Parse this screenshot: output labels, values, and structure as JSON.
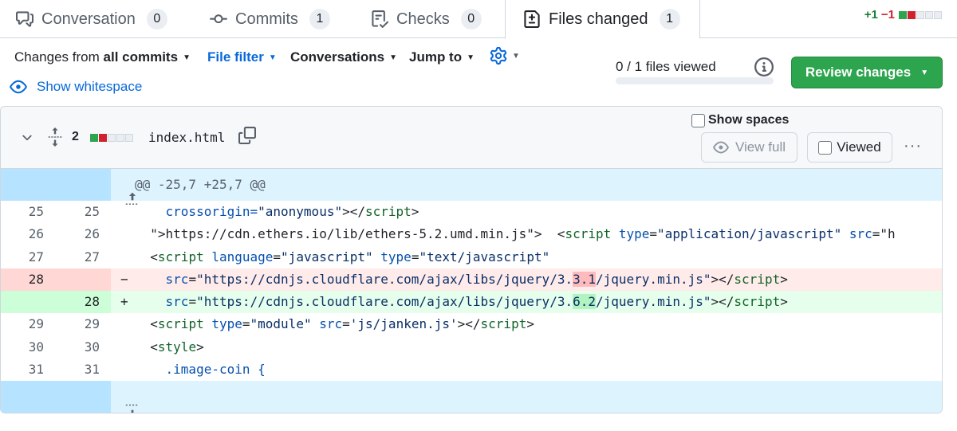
{
  "tabs": [
    {
      "label": "Conversation",
      "count": "0",
      "icon": "comment-discussion-icon"
    },
    {
      "label": "Commits",
      "count": "1",
      "icon": "git-commit-icon"
    },
    {
      "label": "Checks",
      "count": "0",
      "icon": "checklist-icon"
    },
    {
      "label": "Files changed",
      "count": "1",
      "icon": "file-diff-icon"
    }
  ],
  "diffstat": {
    "additions": "+1",
    "deletions": "−1"
  },
  "toolbar": {
    "changes_from_prefix": "Changes from",
    "changes_from_value": "all commits",
    "file_filter": "File filter",
    "conversations": "Conversations",
    "jump_to": "Jump to",
    "show_whitespace": "Show whitespace",
    "files_viewed": "0 / 1 files viewed",
    "files_viewed_progress": 0,
    "review_changes": "Review changes"
  },
  "file": {
    "change_count": "2",
    "name": "index.html",
    "show_spaces": "Show spaces",
    "view_full": "View full",
    "viewed": "Viewed",
    "more": "···"
  },
  "diff": {
    "hunk_header": "@@ -25,7 +25,7 @@",
    "lines": [
      {
        "old": "25",
        "new": "25",
        "marker": "",
        "type": "ctx"
      },
      {
        "old": "26",
        "new": "26",
        "marker": "",
        "type": "ctx"
      },
      {
        "old": "27",
        "new": "27",
        "marker": "",
        "type": "ctx"
      },
      {
        "old": "28",
        "new": "",
        "marker": "−",
        "type": "del"
      },
      {
        "old": "",
        "new": "28",
        "marker": "+",
        "type": "add"
      },
      {
        "old": "29",
        "new": "29",
        "marker": "",
        "type": "ctx"
      },
      {
        "old": "30",
        "new": "30",
        "marker": "",
        "type": "ctx"
      },
      {
        "old": "31",
        "new": "31",
        "marker": "",
        "type": "ctx"
      }
    ],
    "code": {
      "l25": [
        "    crossorigin=",
        "\"anonymous\"",
        "></",
        "script",
        ">"
      ],
      "l26": [
        "  \">https://cdn.ethers.io/lib/ethers-5.2.umd.min.js\">  <",
        "script",
        " ",
        "type",
        "=",
        "\"application/javascript\"",
        " ",
        "src",
        "=\"h"
      ],
      "l27": [
        "  <",
        "script",
        " ",
        "language",
        "=",
        "\"javascript\"",
        " ",
        "type",
        "=",
        "\"text/javascript\""
      ],
      "l28del": [
        "    ",
        "src",
        "=",
        "\"https://cdnjs.cloudflare.com/ajax/libs/jquery/3.",
        "3.1",
        "/jquery.min.js\"",
        "></",
        "script",
        ">"
      ],
      "l28add": [
        "    ",
        "src",
        "=",
        "\"https://cdnjs.cloudflare.com/ajax/libs/jquery/3.",
        "6.2",
        "/jquery.min.js\"",
        "></",
        "script",
        ">"
      ],
      "l29": [
        "  <",
        "script",
        " ",
        "type",
        "=",
        "\"module\"",
        " ",
        "src",
        "=",
        "'js/janken.js'",
        "></",
        "script",
        ">"
      ],
      "l30": [
        "  <",
        "style",
        ">"
      ],
      "l31": [
        "    .image-coin {"
      ]
    }
  }
}
